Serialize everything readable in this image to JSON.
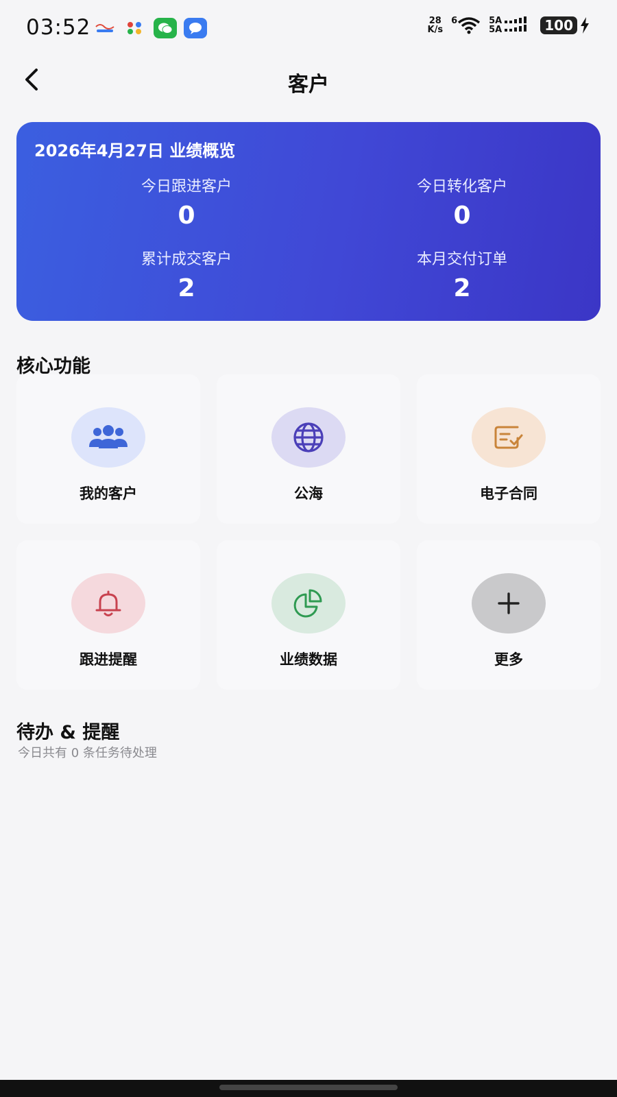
{
  "status_bar": {
    "time": "03:52",
    "net_speed_value": "28",
    "net_speed_unit": "K/s",
    "wifi_label": "6",
    "signal_label_1": "5A",
    "signal_label_2": "5A",
    "battery": "100"
  },
  "header": {
    "title": "客户"
  },
  "overview": {
    "title": "2026年4月27日 业绩概览",
    "stats": [
      {
        "label": "今日跟进客户",
        "value": "0"
      },
      {
        "label": "今日转化客户",
        "value": "0"
      },
      {
        "label": "累计成交客户",
        "value": "2"
      },
      {
        "label": "本月交付订单",
        "value": "2"
      }
    ]
  },
  "core": {
    "title": "核心功能",
    "items": [
      {
        "label": "我的客户",
        "icon": "users-icon",
        "bg": "#dde4fb",
        "fg": "#3e66d8"
      },
      {
        "label": "公海",
        "icon": "globe-icon",
        "bg": "#dcdaf3",
        "fg": "#4a3fb8"
      },
      {
        "label": "电子合同",
        "icon": "contract-icon",
        "bg": "#f7e4d4",
        "fg": "#c9843a"
      },
      {
        "label": "跟进提醒",
        "icon": "bell-icon",
        "bg": "#f5d9dd",
        "fg": "#c8424f"
      },
      {
        "label": "业绩数据",
        "icon": "pie-chart-icon",
        "bg": "#d9eadf",
        "fg": "#2f9a52"
      },
      {
        "label": "更多",
        "icon": "plus-icon",
        "bg": "#c9c9cb",
        "fg": "#222222"
      }
    ]
  },
  "todo": {
    "title": "待办 & 提醒",
    "subtitle": "今日共有 0 条任务待处理"
  }
}
